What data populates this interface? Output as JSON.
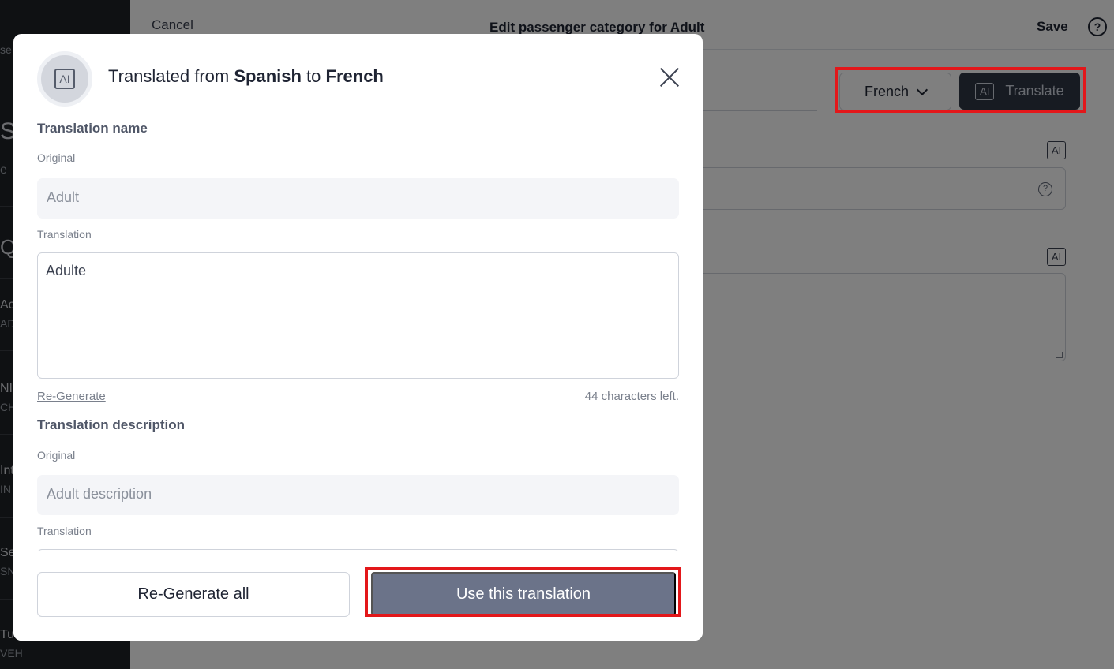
{
  "background": {
    "sidebar": {
      "fragments": [
        {
          "text": "se"
        },
        {
          "text": "S"
        },
        {
          "text": "e"
        },
        {
          "text": "Q"
        },
        {
          "text": "Ac",
          "sub": "AD"
        },
        {
          "text": "NI",
          "sub": "CH"
        },
        {
          "text": "Int",
          "sub": "IN"
        },
        {
          "text": "Se",
          "sub": "SN"
        },
        {
          "text": "Tu",
          "sub": "VEH"
        }
      ]
    },
    "topbar": {
      "cancel_label": "Cancel",
      "title": "Edit passenger category for Adult",
      "save_label": "Save",
      "help_icon": "?"
    },
    "language_select": {
      "value": "French"
    },
    "translate_button": {
      "ai_label": "AI",
      "label": "Translate"
    },
    "name_ai_label": "AI",
    "description_ai_label": "AI",
    "field_help_icon": "?"
  },
  "modal": {
    "ai_label": "AI",
    "title": {
      "prefix": "Translated from ",
      "source_language": "Spanish",
      "middle": " to ",
      "target_language": "French"
    },
    "translation_name": {
      "section_title": "Translation name",
      "original_label": "Original",
      "original_value": "Adult",
      "translation_label": "Translation",
      "translation_value": "Adulte",
      "regenerate_label": "Re-Generate",
      "chars_left": "44 characters left."
    },
    "translation_description": {
      "section_title": "Translation description",
      "original_label": "Original",
      "original_value": "Adult description",
      "translation_label": "Translation",
      "translation_value": ""
    },
    "footer": {
      "regenerate_all_label": "Re-Generate all",
      "use_translation_label": "Use this translation"
    }
  },
  "colors": {
    "highlight": "#e3171a",
    "primary_button": "#6b7389",
    "translate_button": "#2f3645",
    "sidebar": "#1f2226"
  }
}
